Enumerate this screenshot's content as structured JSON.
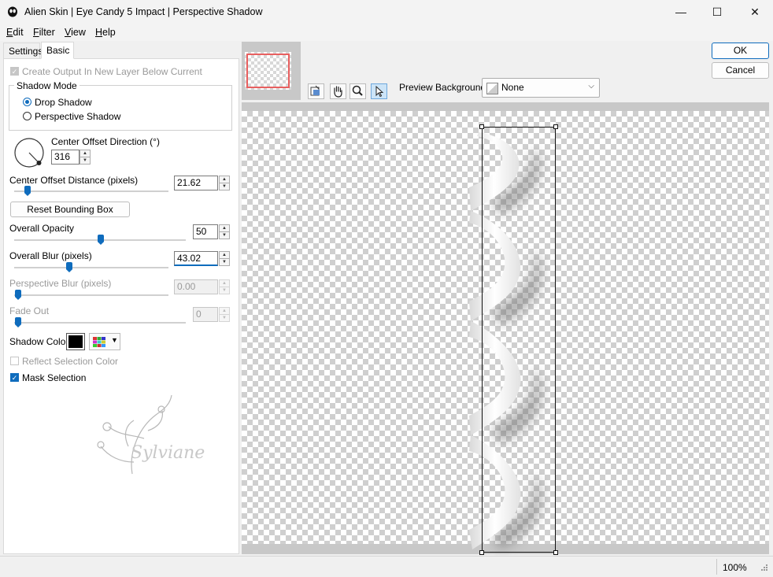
{
  "window": {
    "title": "Alien Skin | Eye Candy 5 Impact | Perspective Shadow",
    "controls": {
      "minimize": "—",
      "maximize": "☐",
      "close": "✕"
    }
  },
  "menu": {
    "items": [
      {
        "label": "Edit",
        "accel": "E",
        "rest": "dit"
      },
      {
        "label": "Filter",
        "accel": "F",
        "rest": "ilter"
      },
      {
        "label": "View",
        "accel": "V",
        "rest": "iew"
      },
      {
        "label": "Help",
        "accel": "H",
        "rest": "elp"
      }
    ]
  },
  "tabs": [
    {
      "label": "Settings",
      "active": false
    },
    {
      "label": "Basic",
      "active": true
    }
  ],
  "basic": {
    "create_output": {
      "label": "Create Output In New Layer Below Current",
      "checked": true,
      "enabled": false
    },
    "shadow_mode": {
      "title": "Shadow Mode",
      "options": [
        {
          "label": "Drop Shadow",
          "selected": true
        },
        {
          "label": "Perspective Shadow",
          "selected": false
        }
      ]
    },
    "center_offset_direction": {
      "label": "Center Offset Direction (°)",
      "value": "316"
    },
    "center_offset_distance": {
      "label": "Center Offset Distance (pixels)",
      "value": "21.62",
      "fraction": 0.1
    },
    "reset_button": "Reset Bounding Box",
    "overall_opacity": {
      "label": "Overall Opacity",
      "value": "50",
      "fraction": 0.5
    },
    "overall_blur": {
      "label": "Overall Blur (pixels)",
      "value": "43.02",
      "fraction": 0.35
    },
    "perspective_blur": {
      "label": "Perspective Blur (pixels)",
      "value": "0.00",
      "fraction": 0,
      "enabled": false
    },
    "fade_out": {
      "label": "Fade Out",
      "value": "0",
      "fraction": 0,
      "enabled": false
    },
    "shadow_color": {
      "label": "Shadow Color",
      "color": "#000000"
    },
    "reflect_selection_color": {
      "label": "Reflect Selection Color",
      "checked": false,
      "enabled": false
    },
    "mask_selection": {
      "label": "Mask Selection",
      "checked": true
    },
    "watermark": "Sylviane"
  },
  "buttons": {
    "ok": "OK",
    "cancel": "Cancel"
  },
  "preview": {
    "background_label": "Preview Background:",
    "background_value": "None",
    "tools": [
      "bounding-box-tool-icon",
      "hand-icon",
      "zoom-icon",
      "arrow-icon"
    ]
  },
  "status": {
    "zoom": "100%"
  },
  "colors": {
    "accent": "#0f6cbd",
    "selection_rect": "#e86060"
  }
}
